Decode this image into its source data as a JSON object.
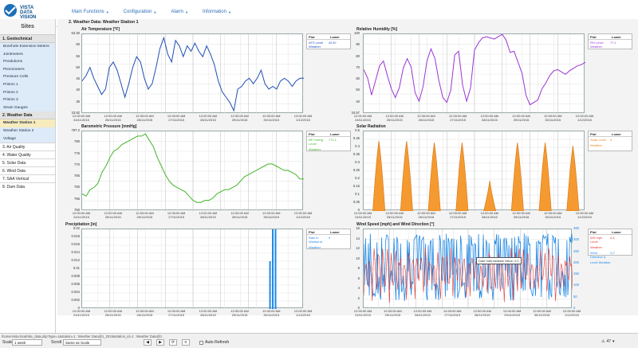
{
  "brand": {
    "line1": "VISTA",
    "line2": "DATA",
    "line3": "VISION"
  },
  "nav": [
    {
      "label": "Main Functions"
    },
    {
      "label": "Configuration"
    },
    {
      "label": "Alarm"
    },
    {
      "label": "Information"
    }
  ],
  "sidebar": {
    "title": "Sites",
    "geotechnical": {
      "heading": "1. Geotechnical",
      "items": [
        "Borehole Extension Meters",
        "Jointmeters",
        "Pendulums",
        "Piezometers",
        "Pressure Cells",
        "Prisms 1",
        "Prisms 2",
        "Prisms 3",
        "Strain Gauges"
      ]
    },
    "weather": {
      "heading": "2. Weather Data",
      "items": [
        "Weather Station 1",
        "Weather Station 2",
        "Voltage"
      ],
      "active_index": 0
    },
    "categories": [
      "3. Air Quality",
      "4. Water Quality",
      "5. Solar Data",
      "6. Wind Data",
      "7. SAA Vertical",
      "8. Dam Data"
    ]
  },
  "page_title": "2. Weather Data: Weather Station 1",
  "x_ticks": [
    "12:00:00 AM\n24/11/2015",
    "12:00:00 AM\n25/11/2015",
    "12:00:00 AM\n26/11/2015",
    "12:00:00 AM\n27/11/2015",
    "12:00:00 AM\n28/11/2015",
    "12:00:00 AM\n29/11/2015",
    "12:00:00 AM\n30/11/2015",
    "12:00:00 AM\n1/12/2015"
  ],
  "legend_headers": {
    "plot": "Plot",
    "lower": "Lower"
  },
  "charts": {
    "temp": {
      "title": "Air Temperature [°F]",
      "yticks": [
        "63.30",
        "60",
        "55",
        "50",
        "45",
        "40",
        "35",
        "33.82"
      ],
      "legend": "ATS Level Weather",
      "legend_val": "42.6+"
    },
    "humid": {
      "title": "Relative Humidity [%]",
      "yticks": [
        "100",
        "90",
        "80",
        "70",
        "60",
        "50",
        "40",
        "34.57"
      ],
      "legend": "RH Level Weather",
      "legend_val": "77.1"
    },
    "press": {
      "title": "Barometric Pressure [mmHg]",
      "yticks": [
        "787.2",
        "780",
        "775",
        "770",
        "765",
        "760",
        "755",
        "750"
      ],
      "legend": "BP mmHg Level",
      "legend_sub": "Weather",
      "legend_val": "771.1"
    },
    "solar": {
      "title": "Solar Radiation",
      "yticks": [
        "0.5",
        "0.45",
        "0.4",
        "0.35",
        "0.3",
        "0.25",
        "0.2",
        "0.15",
        "0.1",
        "0.05",
        "0"
      ],
      "legend": "Solar Level",
      "legend_sub": "Weather",
      "legend_val": "0"
    },
    "precip": {
      "title": "Precipitation [in]",
      "yticks": [
        "0.02",
        "0.018",
        "0.016",
        "0.014",
        "0.012",
        "0.01",
        "0.008",
        "0.006",
        "0.004",
        "0.002",
        "0"
      ],
      "legend": "Rain in Weekend",
      "legend_sub": "Weather",
      "legend_val": "0"
    },
    "wind": {
      "title": "Wind Speed [mph] and Wind Direction [°]",
      "yticks": [
        "16",
        "14",
        "12",
        "10",
        "8",
        "6",
        "4",
        "2",
        "0"
      ],
      "yticks2": [
        "360",
        "300",
        "250",
        "200",
        "150",
        "100",
        "50",
        "0"
      ],
      "legend": "WS mph Level",
      "legend_sub": "Weather",
      "legend2": "Wind Direction &",
      "legend2_sub": "Level Weather",
      "legend_val": "4.4",
      "legend2_val": "4.2",
      "tooltip": "Date Intermediate Value: 0.0"
    }
  },
  "chart_data": [
    {
      "type": "line",
      "title": "Air Temperature [°F]",
      "ylim": [
        33.82,
        63.3
      ],
      "series": [
        {
          "name": "ATS Level Weather",
          "values": [
            46,
            48,
            51,
            47,
            44,
            41,
            43,
            51,
            53,
            50,
            45,
            40,
            45,
            51,
            55,
            53,
            47,
            43,
            45,
            51,
            58,
            62,
            56,
            53,
            61,
            59,
            55,
            59,
            57,
            60,
            57,
            55,
            59,
            56,
            52,
            46,
            42,
            40,
            38,
            35,
            43,
            44,
            46,
            47,
            45,
            47,
            50,
            45,
            43,
            44,
            43,
            46,
            47,
            46,
            44,
            46,
            47,
            47
          ]
        }
      ]
    },
    {
      "type": "line",
      "title": "Relative Humidity [%]",
      "ylim": [
        34.57,
        100
      ],
      "series": [
        {
          "name": "RH Level Weather",
          "values": [
            71,
            64,
            50,
            62,
            74,
            78,
            66,
            55,
            48,
            56,
            72,
            80,
            73,
            52,
            45,
            57,
            78,
            88,
            80,
            62,
            48,
            44,
            54,
            83,
            86,
            58,
            45,
            56,
            87,
            93,
            97,
            98,
            97,
            96,
            98,
            100,
            95,
            85,
            86,
            77,
            68,
            50,
            42,
            44,
            46,
            55,
            60,
            66,
            70,
            71,
            69,
            67,
            70,
            72,
            74,
            75,
            77
          ]
        }
      ]
    },
    {
      "type": "line",
      "title": "Barometric Pressure [mmHg]",
      "ylim": [
        750,
        787.2
      ],
      "series": [
        {
          "name": "BP mmHg Level Weather",
          "values": [
            758,
            757,
            760,
            761,
            763,
            768,
            771,
            775,
            778,
            779,
            781,
            782,
            783,
            784,
            785,
            785,
            786,
            783,
            780,
            775,
            771,
            767,
            764,
            762,
            761,
            760,
            759,
            757,
            755,
            754,
            754,
            755,
            755,
            756,
            758,
            759,
            760,
            760,
            761,
            762,
            764,
            766,
            767,
            768,
            769,
            770,
            771,
            772,
            772,
            771,
            770,
            769,
            769,
            768,
            767,
            765,
            765
          ]
        }
      ]
    },
    {
      "type": "area",
      "title": "Solar Radiation",
      "ylim": [
        0,
        0.5
      ],
      "series": [
        {
          "name": "Solar Level Weather",
          "peaks": [
            0.44,
            0.44,
            0.43,
            0.43,
            0.19,
            0.43,
            0.43,
            0.41
          ]
        }
      ]
    },
    {
      "type": "bar",
      "title": "Precipitation [in]",
      "ylim": [
        0,
        0.02
      ],
      "series": [
        {
          "name": "Rain in Weekend Weather",
          "x": [
            6.75,
            6.85,
            6.95
          ],
          "values": [
            0.012,
            0.02,
            0.02
          ]
        }
      ]
    },
    {
      "type": "line",
      "title": "Wind Speed [mph] and Wind Direction [°]",
      "ylim": [
        0,
        16
      ],
      "series": [
        {
          "name": "WS mph Level Weather",
          "note": "dense oscillating series 0–16 mph"
        },
        {
          "name": "Wind Direction & Level Weather",
          "note": "dense oscillating series 0–360°"
        }
      ]
    }
  ],
  "footer": {
    "url": "/home/vista.local/site_data.php?type=1&station=1 : Weather Data@1_2015&station_id=1 : Weather Data@1",
    "scale_label": "Scale",
    "scale_value": "1 week",
    "scroll_label": "Scroll",
    "scroll_value": "Same as Scale",
    "auto_refresh": "Auto Refresh",
    "alerts_count": "47"
  }
}
